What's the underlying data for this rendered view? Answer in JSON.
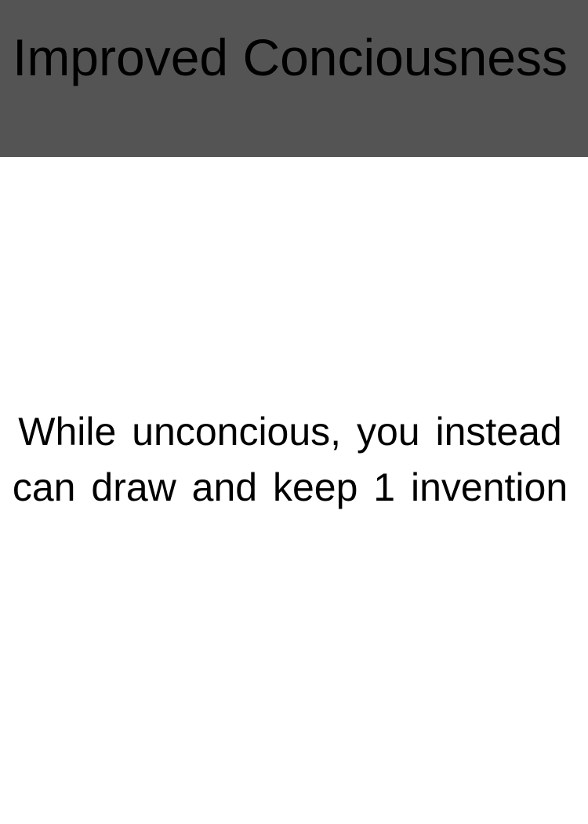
{
  "card": {
    "title": "Improved Conciousness",
    "text": "While unconcious, you instead can draw and keep 1 invention",
    "header_color": "#545454",
    "body_color": "#ffffff",
    "text_color": "#000000"
  }
}
